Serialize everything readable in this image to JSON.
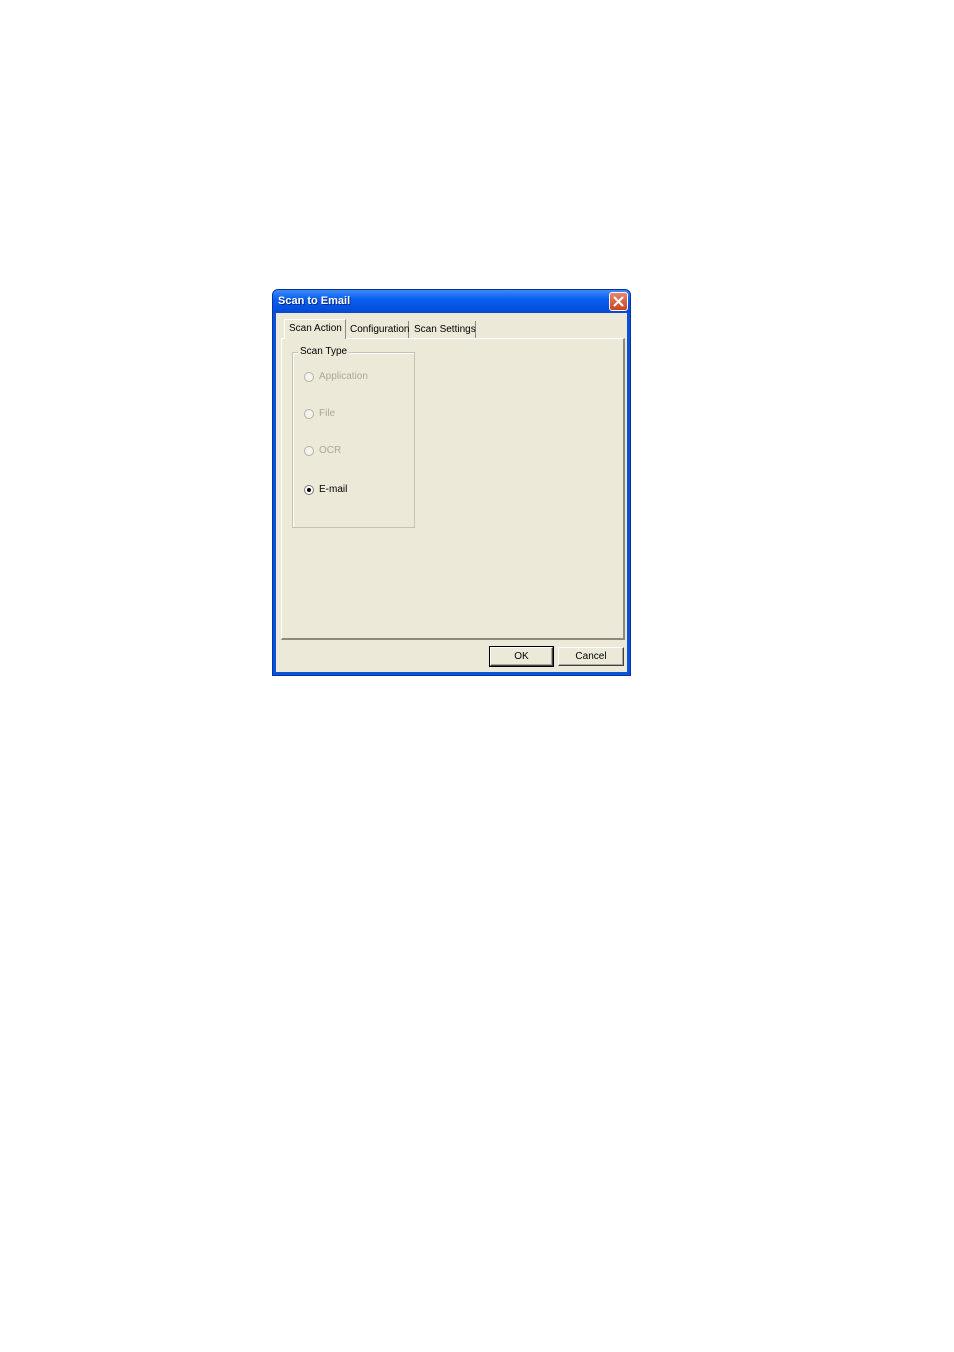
{
  "window": {
    "title": "Scan to Email"
  },
  "tabs": [
    {
      "label": "Scan Action",
      "active": true
    },
    {
      "label": "Configuration",
      "active": false
    },
    {
      "label": "Scan Settings",
      "active": false
    }
  ],
  "scan_type": {
    "title": "Scan Type",
    "options": [
      {
        "label": "Application",
        "enabled": false,
        "selected": false
      },
      {
        "label": "File",
        "enabled": false,
        "selected": false
      },
      {
        "label": "OCR",
        "enabled": false,
        "selected": false
      },
      {
        "label": "E-mail",
        "enabled": true,
        "selected": true
      }
    ]
  },
  "buttons": {
    "ok": "OK",
    "cancel": "Cancel"
  }
}
